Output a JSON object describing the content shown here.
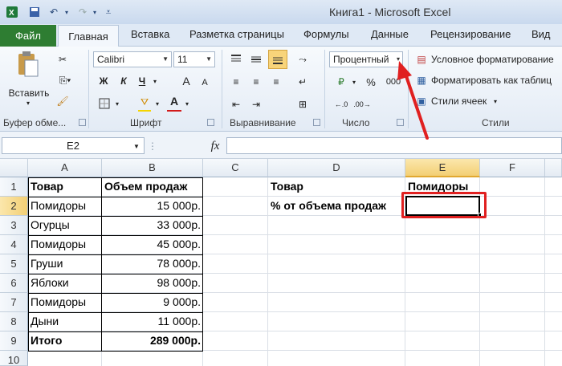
{
  "window": {
    "title": "Книга1  -  Microsoft Excel"
  },
  "tabs": [
    "Файл",
    "Главная",
    "Вставка",
    "Разметка страницы",
    "Формулы",
    "Данные",
    "Рецензирование",
    "Вид"
  ],
  "ribbon": {
    "clipboard": {
      "paste_label": "Вставить",
      "group_label": "Буфер обме..."
    },
    "font": {
      "name": "Calibri",
      "size": "11",
      "group_label": "Шрифт",
      "bold": "Ж",
      "italic": "К",
      "underline": "Ч",
      "grow": "A",
      "shrink": "A",
      "color": "A"
    },
    "alignment": {
      "group_label": "Выравнивание"
    },
    "number": {
      "format": "Процентный",
      "percent": "%",
      "thousands": "000",
      "group_label": "Число"
    },
    "styles": {
      "conditional": "Условное форматирование",
      "format_table": "Форматировать как таблиц",
      "cell_styles": "Стили ячеек",
      "group_label": "Стили"
    }
  },
  "formula_bar": {
    "name_box": "E2",
    "fx": "fx",
    "value": ""
  },
  "columns": [
    "A",
    "B",
    "C",
    "D",
    "E",
    "F"
  ],
  "rows": [
    "1",
    "2",
    "3",
    "4",
    "5",
    "6",
    "7",
    "8",
    "9",
    "10"
  ],
  "cells": {
    "A1": "Товар",
    "B1": "Объем продаж",
    "A2": "Помидоры",
    "B2": "15 000р.",
    "A3": "Огурцы",
    "B3": "33 000р.",
    "A4": "Помидоры",
    "B4": "45 000р.",
    "A5": "Груши",
    "B5": "78 000р.",
    "A6": "Яблоки",
    "B6": "98 000р.",
    "A7": "Помидоры",
    "B7": "9 000р.",
    "A8": "Дыни",
    "B8": "11 000р.",
    "A9": "Итого",
    "B9": "289 000р.",
    "D1": "Товар",
    "E1": "Помидоры",
    "D2": "% от объема продаж",
    "E2": ""
  },
  "selected_cell": "E2",
  "colors": {
    "file_tab": "#2e7d32",
    "annotation": "#e02020",
    "selected_col": "#f6d88c"
  }
}
